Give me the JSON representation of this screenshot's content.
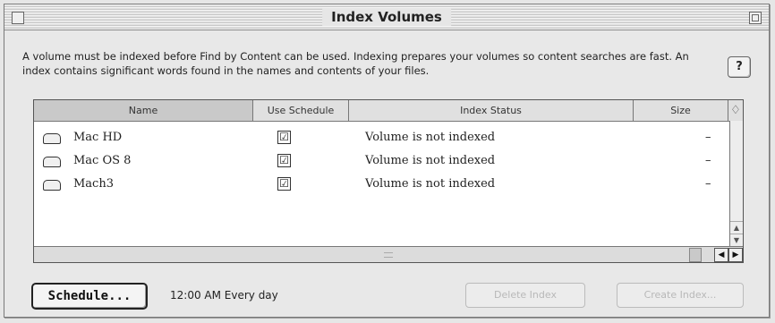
{
  "window": {
    "title": "Index Volumes",
    "description": "A volume must be indexed before Find by Content can be used. Indexing prepares your volumes so content searches are fast.  An index contains significant words found in the names and contents of your files.",
    "help_label": "?"
  },
  "table": {
    "columns": [
      "Name",
      "Use Schedule",
      "Index Status",
      "Size"
    ],
    "corner_label": "♢",
    "rows": [
      {
        "name": "Mac HD",
        "use_schedule": "☑",
        "status": "Volume is not indexed",
        "size": "–"
      },
      {
        "name": "Mac OS 8",
        "use_schedule": "☑",
        "status": "Volume is not indexed",
        "size": "–"
      },
      {
        "name": "Mach3",
        "use_schedule": "☑",
        "status": "Volume is not indexed",
        "size": "–"
      }
    ]
  },
  "footer": {
    "schedule_button": "Schedule...",
    "schedule_text": "12:00 AM Every day",
    "delete_button": "Delete Index",
    "create_button": "Create Index..."
  }
}
